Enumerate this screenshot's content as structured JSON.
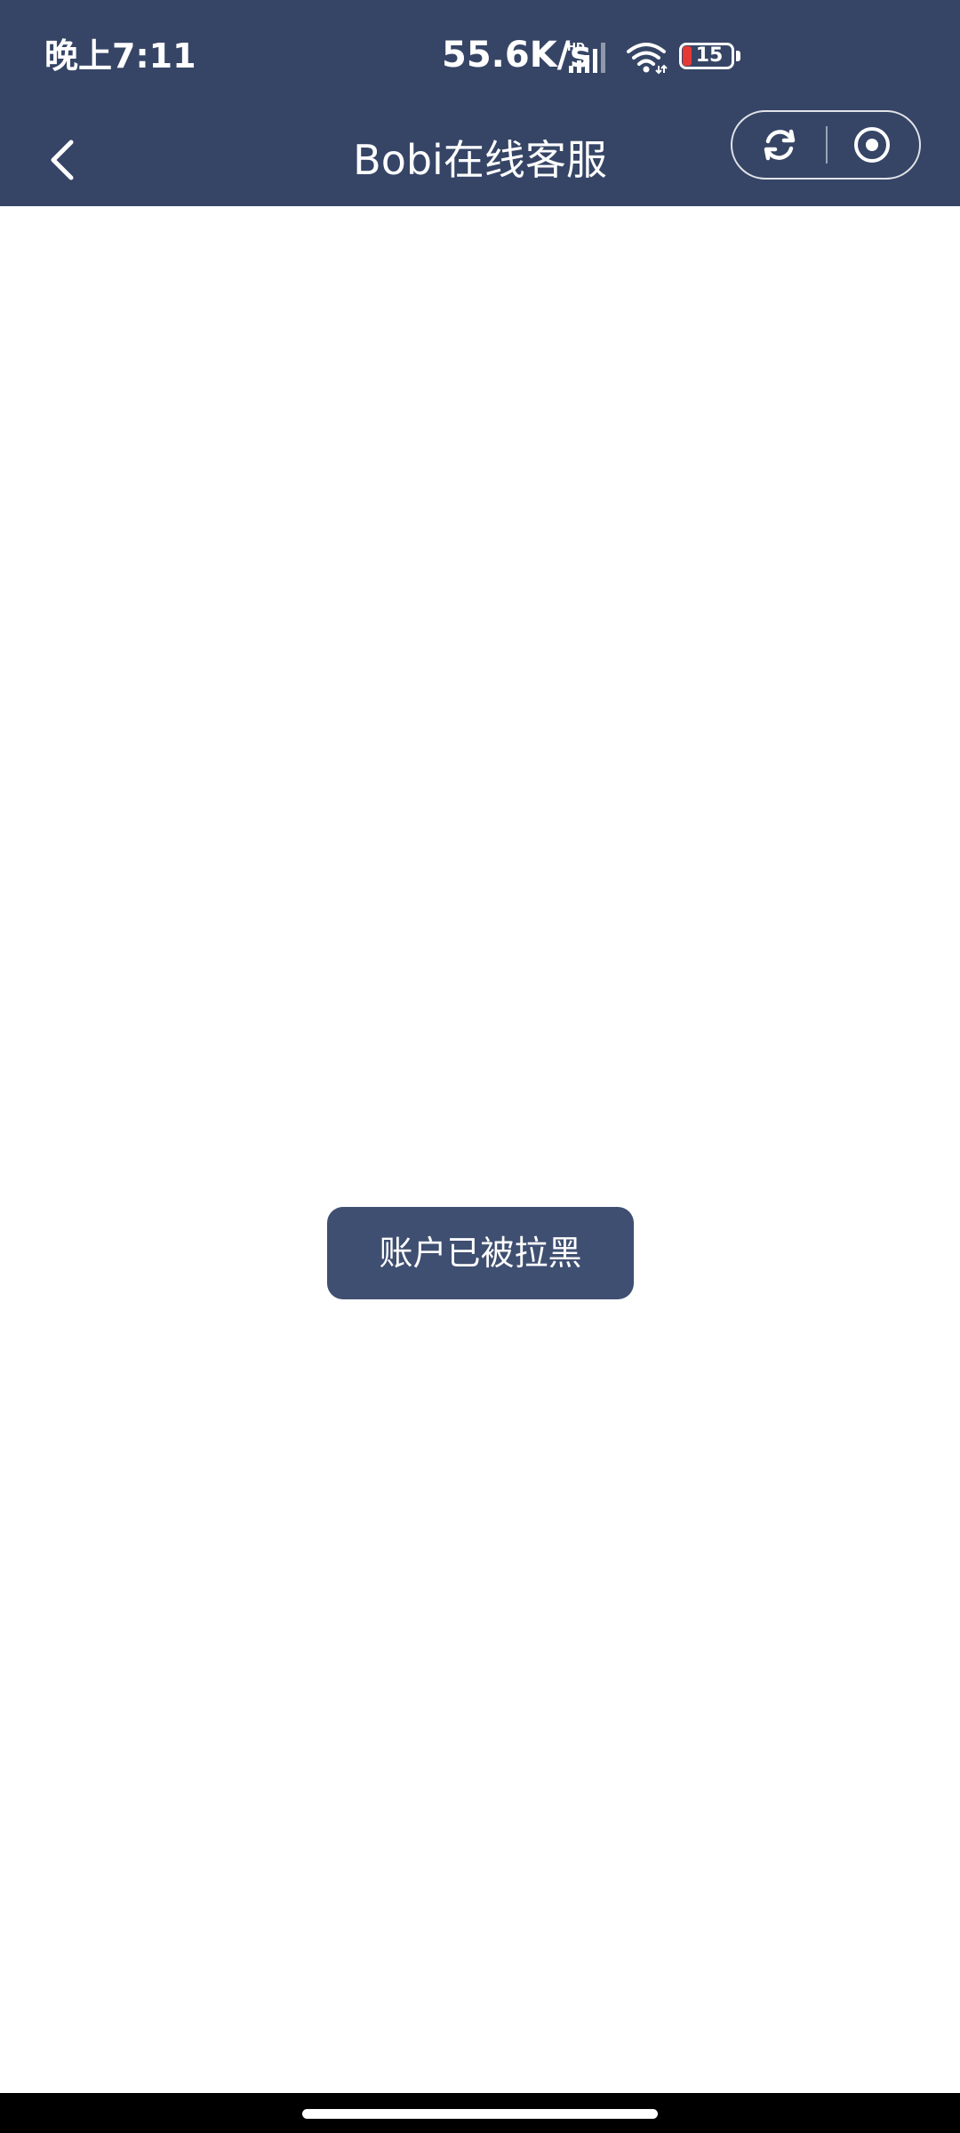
{
  "status_bar": {
    "time": "晚上7:11",
    "network_speed": "55.6K/s",
    "battery_level": "15",
    "icons": [
      "hd-signal-icon",
      "wifi-icon",
      "battery-icon"
    ]
  },
  "nav": {
    "title": "Bobi在线客服",
    "back_icon": "chevron-left-icon",
    "capsule": {
      "left_icon": "refresh-icon",
      "right_icon": "close-circle-icon"
    }
  },
  "toast": {
    "message": "账户已被拉黑"
  },
  "colors": {
    "header_bg": "#364566",
    "toast_bg": "#3f4f71",
    "battery_low": "#e53935"
  }
}
